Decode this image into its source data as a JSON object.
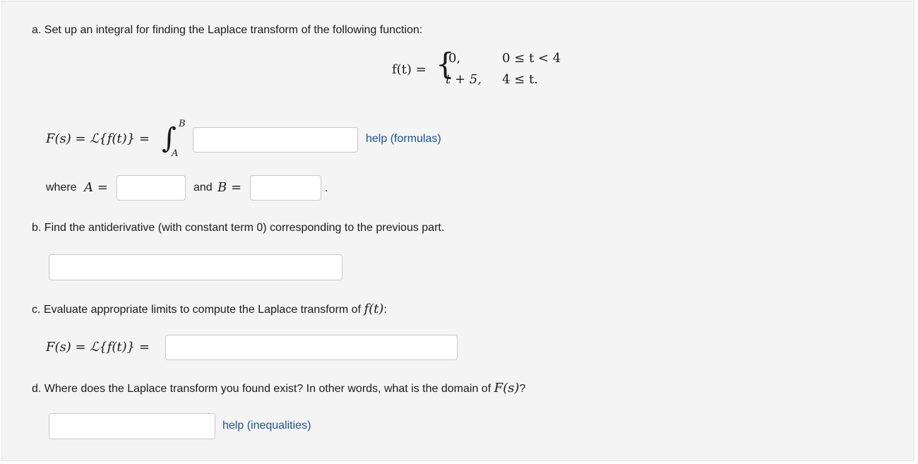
{
  "part_a": {
    "prompt": "a. Set up an integral for finding the Laplace transform of the following function:",
    "function_lhs": "f(t) =",
    "case1_value": "0,",
    "case1_condition": "0 ≤ t < 4",
    "case2_value": "t + 5,",
    "case2_condition": "4 ≤ t.",
    "transform_lhs": "F(s) = ℒ{f(t)} =",
    "integral_upper": "B",
    "integral_lower": "A",
    "help_formulas": "help (formulas)",
    "where_label": "where",
    "A_label": "A =",
    "and_label": "and",
    "B_label": "B =",
    "period": "."
  },
  "part_b": {
    "prompt": "b. Find the antiderivative (with constant term 0) corresponding to the previous part."
  },
  "part_c": {
    "prompt": "c. Evaluate appropriate limits to compute the Laplace transform of",
    "prompt_math": "f(t)",
    "prompt_end": ":",
    "transform_lhs": "F(s) = ℒ{f(t)} ="
  },
  "part_d": {
    "prompt": "d. Where does the Laplace transform you found exist? In other words, what is the domain of",
    "prompt_math": "F(s)",
    "prompt_end": "?",
    "help_inequalities": "help (inequalities)"
  }
}
